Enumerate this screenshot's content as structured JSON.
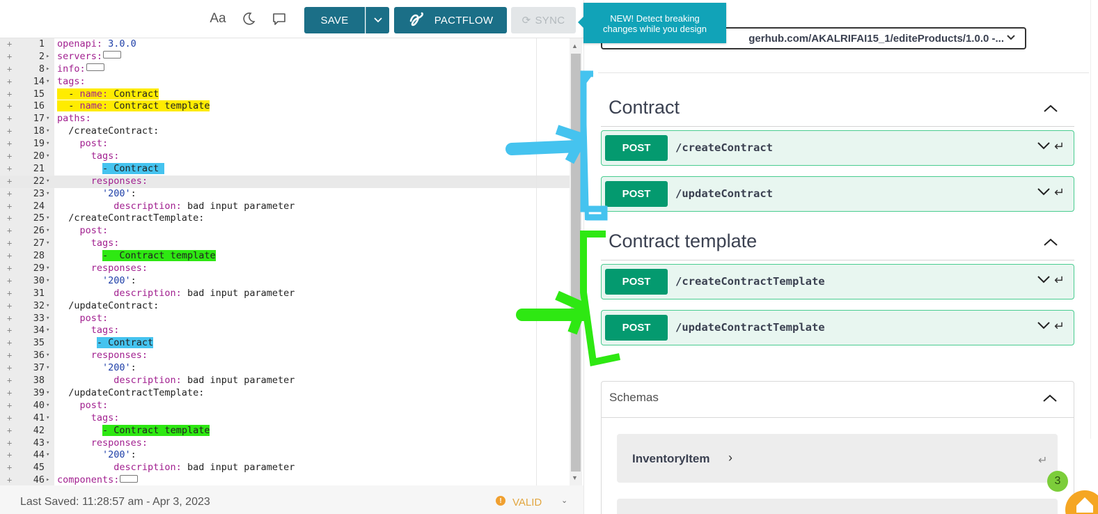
{
  "toolbar": {
    "font_label": "Aa",
    "save_label": "SAVE",
    "pactflow_label": "PACTFLOW",
    "sync_label": "SYNC"
  },
  "tooltip": {
    "line1": "NEW! Detect breaking",
    "line2": "changes while you design"
  },
  "editor": {
    "lines": [
      {
        "n": "1",
        "fold": "",
        "html": "<span class=\"k\">openapi:</span> <span class=\"s\">3.0.0</span>"
      },
      {
        "n": "2",
        "fold": "▸",
        "html": "<span class=\"k\">servers:</span><span class=\"collapsed\"></span>"
      },
      {
        "n": "8",
        "fold": "▸",
        "html": "<span class=\"k\">info:</span><span class=\"collapsed\"></span>"
      },
      {
        "n": "14",
        "fold": "▾",
        "html": "<span class=\"k\">tags:</span>"
      },
      {
        "n": "15",
        "fold": "",
        "html": "<span class=\"hl-yellow\">  - <span class=\"k\">name:</span> Contract</span>"
      },
      {
        "n": "16",
        "fold": "",
        "html": "<span class=\"hl-yellow\">  - <span class=\"k\">name:</span> Contract template</span>"
      },
      {
        "n": "17",
        "fold": "▾",
        "html": "<span class=\"k\">paths:</span>"
      },
      {
        "n": "18",
        "fold": "▾",
        "html": "  /createContract:"
      },
      {
        "n": "19",
        "fold": "▾",
        "html": "    <span class=\"k\">post:</span>"
      },
      {
        "n": "20",
        "fold": "▾",
        "html": "      <span class=\"k\">tags:</span>"
      },
      {
        "n": "21",
        "fold": "",
        "html": "        <span class=\"hl-blue\">- Contract </span>"
      },
      {
        "n": "22",
        "fold": "▾",
        "html": "      <span class=\"k\">responses:</span>",
        "active": true
      },
      {
        "n": "23",
        "fold": "▾",
        "html": "        <span class=\"s\">'200'</span>:"
      },
      {
        "n": "24",
        "fold": "",
        "html": "          <span class=\"k\">description:</span> bad input parameter"
      },
      {
        "n": "25",
        "fold": "▾",
        "html": "  /createContractTemplate:"
      },
      {
        "n": "26",
        "fold": "▾",
        "html": "    <span class=\"k\">post:</span>"
      },
      {
        "n": "27",
        "fold": "▾",
        "html": "      <span class=\"k\">tags:</span>"
      },
      {
        "n": "28",
        "fold": "",
        "html": "        <span class=\"hl-green\">-  Contract template</span>"
      },
      {
        "n": "29",
        "fold": "▾",
        "html": "      <span class=\"k\">responses:</span>"
      },
      {
        "n": "30",
        "fold": "▾",
        "html": "        <span class=\"s\">'200'</span>:"
      },
      {
        "n": "31",
        "fold": "",
        "html": "          <span class=\"k\">description:</span> bad input parameter"
      },
      {
        "n": "32",
        "fold": "▾",
        "html": "  /updateContract:"
      },
      {
        "n": "33",
        "fold": "▾",
        "html": "    <span class=\"k\">post:</span>"
      },
      {
        "n": "34",
        "fold": "▾",
        "html": "      <span class=\"k\">tags:</span>"
      },
      {
        "n": "35",
        "fold": "",
        "html": "       <span class=\"hl-blue\">- Contract</span>"
      },
      {
        "n": "36",
        "fold": "▾",
        "html": "      <span class=\"k\">responses:</span>"
      },
      {
        "n": "37",
        "fold": "▾",
        "html": "        <span class=\"s\">'200'</span>:"
      },
      {
        "n": "38",
        "fold": "",
        "html": "          <span class=\"k\">description:</span> bad input parameter"
      },
      {
        "n": "39",
        "fold": "▾",
        "html": "  /updateContractTemplate:"
      },
      {
        "n": "40",
        "fold": "▾",
        "html": "    <span class=\"k\">post:</span>"
      },
      {
        "n": "41",
        "fold": "▾",
        "html": "      <span class=\"k\">tags:</span>"
      },
      {
        "n": "42",
        "fold": "",
        "html": "        <span class=\"hl-green\">- Contract template</span>"
      },
      {
        "n": "43",
        "fold": "▾",
        "html": "      <span class=\"k\">responses:</span>"
      },
      {
        "n": "44",
        "fold": "▾",
        "html": "        <span class=\"s\">'200'</span>:"
      },
      {
        "n": "45",
        "fold": "",
        "html": "          <span class=\"k\">description:</span> bad input parameter"
      },
      {
        "n": "46",
        "fold": "▸",
        "html": "<span class=\"k\">components:</span><span class=\"collapsed\"></span>"
      }
    ]
  },
  "status": {
    "last_saved": "Last Saved:  11:28:57 am   -   Apr 3, 2023",
    "valid_label": "VALID"
  },
  "panel": {
    "server_url": "gerhub.com/AKALRIFAI15_1/editeProducts/1.0.0 -...",
    "tags": [
      {
        "name": "Contract",
        "ops": [
          {
            "method": "POST",
            "path": "/createContract"
          },
          {
            "method": "POST",
            "path": "/updateContract"
          }
        ]
      },
      {
        "name": "Contract template",
        "ops": [
          {
            "method": "POST",
            "path": "/createContractTemplate"
          },
          {
            "method": "POST",
            "path": "/updateContractTemplate"
          }
        ]
      }
    ],
    "schemas_title": "Schemas",
    "schema_items": [
      "InventoryItem"
    ],
    "badge_count": "3"
  },
  "colors": {
    "toolbar_button": "#1b6f87",
    "tooltip": "#11a3b8",
    "post_method": "#049a6f",
    "post_border": "#49cc90",
    "post_bg": "#e8f6f0",
    "highlight_yellow": "#ffec00",
    "highlight_blue": "#45c3ef",
    "highlight_green": "#2ee812",
    "valid": "#e2a640"
  }
}
